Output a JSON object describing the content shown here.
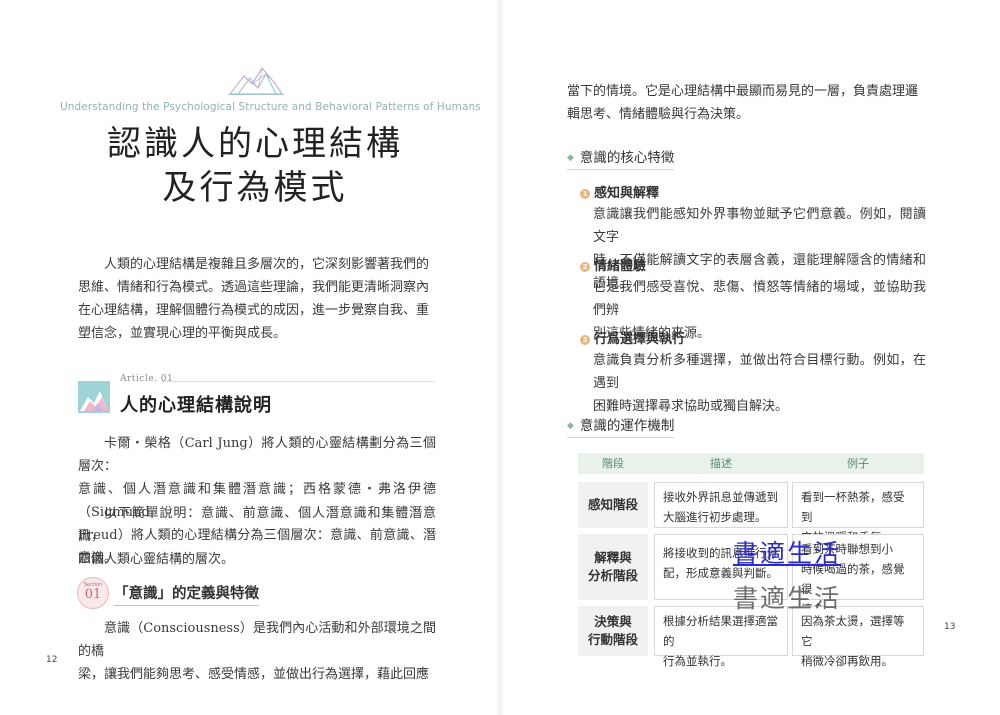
{
  "left_page": {
    "subtitle_en": "Understanding the Psychological Structure and Behavioral Patterns of Humans",
    "title_line1": "認識人的心理結構",
    "title_line2": "及行為模式",
    "intro_line1": "人類的心理結構是複雜且多層次的，它深刻影響著我們的",
    "intro_line2": "思維、情緒和行為模式。透過這些理論，我們能更清晰洞察內",
    "intro_line3": "在心理結構，理解個體行為模式的成因，進一步覺察自我、重",
    "intro_line4": "塑信念，並實現心理的平衡與成長。",
    "article_label": "Article. 01",
    "article_title": "人的心理結構說明",
    "p1_line1": "卡爾・榮格（Carl Jung）將人類的心靈結構劃分為三個層次：",
    "p1_line2": "意識、個人潛意識和集體潛意識；西格蒙德・弗洛伊德（Sigmund",
    "p1_line3": "Freud）將人類的心理結構分為三個層次：意識、前意識、潛意識。",
    "p2_line1": "以下簡單說明：意識、前意識、個人潛意識和集體潛意識，",
    "p2_line2": "四個人類心靈結構的層次。",
    "section_label": "Section",
    "section_number": "01",
    "section_title": "「意識」的定義與特徵",
    "p3_line1": "意識（Consciousness）是我們內心活動和外部環境之間的橋",
    "p3_line2": "梁，讓我們能夠思考、感受情感，並做出行為選擇，藉此回應",
    "page_number": "12"
  },
  "right_page": {
    "top_line1": "當下的情境。它是心理結構中最顯而易見的一層，負責處理邏",
    "top_line2": "輯思考、情緒體驗與行為決策。",
    "heading1": "意識的核心特徵",
    "items": [
      {
        "num": "1",
        "title": "感知與解釋",
        "line1": "意識讓我們能感知外界事物並賦予它們意義。例如，閱讀文字",
        "line2": "時，不僅能解讀文字的表層含義，還能理解隱含的情緒和語境。"
      },
      {
        "num": "2",
        "title": "情緒體驗",
        "line1": "它是我們感受喜悅、悲傷、憤怒等情緒的場域，並協助我們辨",
        "line2": "別這些情緒的來源。"
      },
      {
        "num": "3",
        "title": "行爲選擇與執行",
        "line1": "意識負責分析多種選擇，並做出符合目標行動。例如，在遇到",
        "line2": "困難時選擇尋求協助或獨自解決。"
      }
    ],
    "heading2": "意識的運作機制",
    "table": {
      "headers": [
        "階段",
        "描述",
        "例子"
      ],
      "rows": [
        {
          "stage1": "感知階段",
          "stage2": "",
          "desc1": "接收外界訊息並傳遞到",
          "desc2": "大腦進行初步處理。",
          "desc3": "",
          "ex1": "看到一杯熱茶，感受到",
          "ex2": "它的溫暖和香氣。",
          "ex3": ""
        },
        {
          "stage1": "解釋與",
          "stage2": "分析階段",
          "desc1": "",
          "desc2": "將接收到的訊息進行分",
          "desc3": "配，形成意義與判斷。",
          "ex1": "看到茶時聯想到小",
          "ex2": "時候喝過的茶，感覺很",
          "ex3": "懷念。"
        },
        {
          "stage1": "決策與",
          "stage2": "行動階段",
          "desc1": "根據分析結果選擇適當的",
          "desc2": "行為並執行。",
          "desc3": "",
          "ex1": "因為茶太燙，選擇等它",
          "ex2": "稍微冷卻再飲用。",
          "ex3": ""
        }
      ]
    },
    "watermark1": "書適生活",
    "watermark2": "書適生活",
    "page_number": "13"
  }
}
